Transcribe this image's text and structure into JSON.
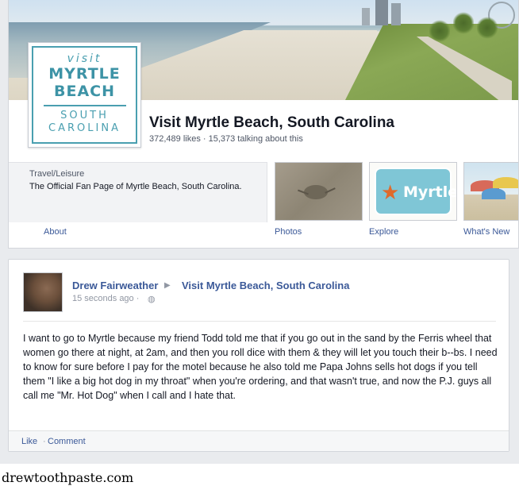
{
  "logo": {
    "line1": "visit",
    "line2": "MYRTLE",
    "line3": "BEACH",
    "line4": "SOUTH",
    "line5": "CAROLINA"
  },
  "page": {
    "name": "Visit Myrtle Beach, South Carolina",
    "stats": "372,489 likes · 15,373 talking about this",
    "category": "Travel/Leisure",
    "description": "The Official Fan Page of Myrtle Beach, South Carolina."
  },
  "tabs": {
    "about": "About",
    "photos": "Photos",
    "explore": "Explore",
    "whats_new": "What's New",
    "explore_thumb_text": "Myrtle"
  },
  "post": {
    "author": "Drew Fairweather",
    "target": "Visit Myrtle Beach, South Carolina",
    "time": "15 seconds ago ·",
    "body": "I want to go to Myrtle because my friend Todd told me that if you go out in the sand by the Ferris wheel that women go there at night, at 2am, and then you roll dice with them & they will let you touch their b--bs. I need to know for sure before I pay for the motel because he also told me Papa Johns sells hot dogs if you tell them \"I like a big hot dog in my throat\" when you're ordering, and that wasn't true, and now the P.J. guys all call me \"Mr. Hot Dog\" when I call and I hate that.",
    "like": "Like",
    "separator": "·",
    "comment": "Comment"
  },
  "watermark": "drewtoothpaste.com",
  "icons": {
    "arrow": "arrow-right-icon",
    "globe": "globe-icon",
    "star": "star-icon"
  },
  "colors": {
    "link": "#3b5998",
    "logo_teal": "#4a9fb0",
    "text": "#141823",
    "meta": "#9197a3"
  }
}
